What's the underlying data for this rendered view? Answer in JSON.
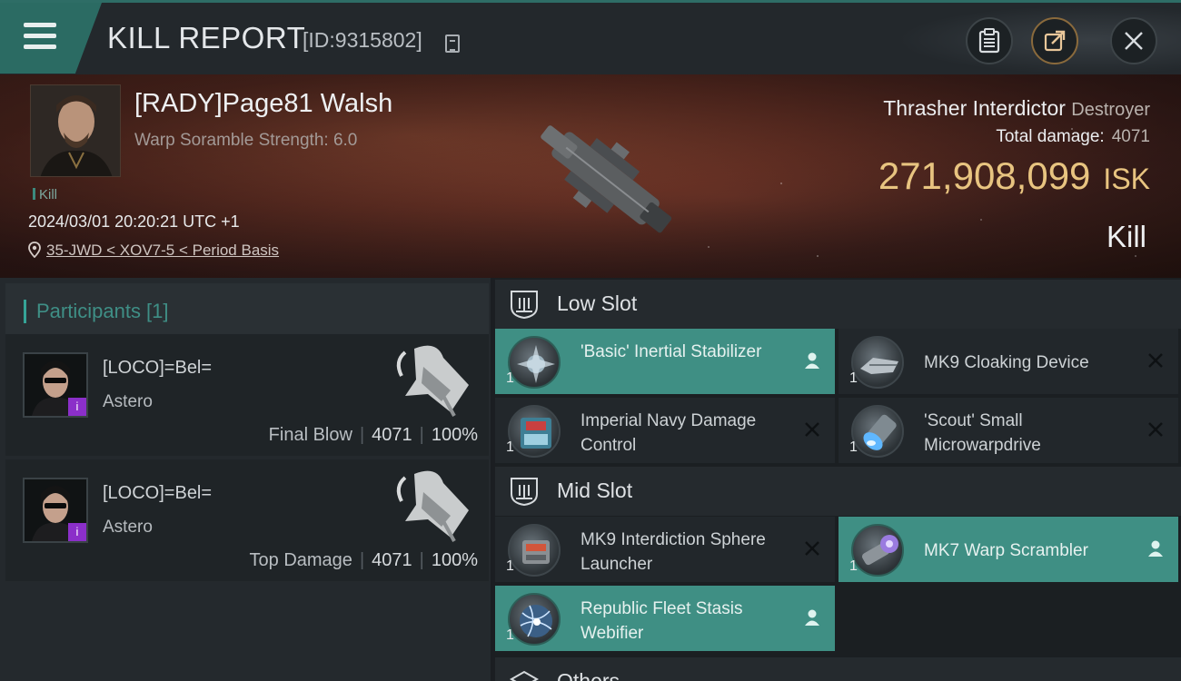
{
  "header": {
    "title": "KILL REPORT",
    "report_id": "[ID:9315802]"
  },
  "victim": {
    "name": "[RADY]Page81 Walsh",
    "scramble_strength": "Warp Soramble Strength: 6.0",
    "kill_tag": "Kill",
    "datetime": "2024/03/01 20:20:21 UTC +1",
    "location": "35-JWD < XOV7-5 < Period Basis",
    "ship_name": "Thrasher Interdictor",
    "ship_class": "Destroyer",
    "total_damage_label": "Total damage:",
    "total_damage": "4071",
    "isk_value": "271,908,099",
    "isk_unit": "ISK",
    "result": "Kill"
  },
  "participants": {
    "title": "Participants [1]",
    "rows": [
      {
        "name": "[LOCO]=Bel=",
        "ship": "Astero",
        "role": "Final Blow",
        "damage": "4071",
        "percent": "100%",
        "badge": "i"
      },
      {
        "name": "[LOCO]=Bel=",
        "ship": "Astero",
        "role": "Top Damage",
        "damage": "4071",
        "percent": "100%",
        "badge": "i"
      }
    ]
  },
  "slots": {
    "low": {
      "label": "Low Slot",
      "items": [
        {
          "name": "'Basic' Inertial Stabilizer",
          "qty": "1",
          "status": "equipped"
        },
        {
          "name": "MK9 Cloaking Device",
          "qty": "1",
          "status": "destroyed"
        },
        {
          "name": "Imperial Navy Damage Control",
          "qty": "1",
          "status": "destroyed"
        },
        {
          "name": "'Scout' Small Microwarpdrive",
          "qty": "1",
          "status": "destroyed"
        }
      ]
    },
    "mid": {
      "label": "Mid Slot",
      "items": [
        {
          "name": "MK9 Interdiction Sphere Launcher",
          "qty": "1",
          "status": "destroyed"
        },
        {
          "name": "MK7 Warp Scrambler",
          "qty": "1",
          "status": "equipped"
        },
        {
          "name": "Republic Fleet Stasis Webifier",
          "qty": "1",
          "status": "equipped"
        }
      ]
    },
    "other": {
      "label": "Others"
    }
  },
  "colors": {
    "accent": "#3f8f84",
    "isk": "#e8c480",
    "badge": "#8b2fc9"
  }
}
